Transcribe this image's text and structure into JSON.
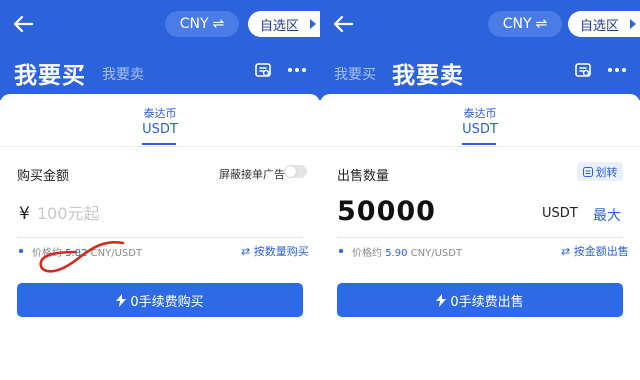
{
  "colors": {
    "brand": "#2c63dc",
    "button": "#2d6ae5",
    "scribble": "#d42a1d"
  },
  "buy": {
    "header": {
      "currency_label": "CNY",
      "currency_switch_icon": "swap-arrows-icon",
      "zone_label": "自选区",
      "tab_active": "我要买",
      "tab_inactive": "我要卖"
    },
    "coin": {
      "name": "泰达币",
      "symbol": "USDT"
    },
    "field_title": "购买金额",
    "hide_toggle_label": "屏蔽接单广告",
    "hide_toggle_on": false,
    "currency_symbol": "¥",
    "amount_placeholder": "100元起",
    "price_prefix": "价格约",
    "price_value": "5.82",
    "price_unit": "CNY/USDT",
    "switch_mode_label": "⇄ 按数量购买",
    "submit_label": "0手续费购买"
  },
  "sell": {
    "header": {
      "currency_label": "CNY",
      "zone_label": "自选区",
      "tab_inactive": "我要买",
      "tab_active": "我要卖"
    },
    "coin": {
      "name": "泰达币",
      "symbol": "USDT"
    },
    "field_title": "出售数量",
    "transfer_label": "划转",
    "quantity": "50000",
    "unit": "USDT",
    "max_label": "最大",
    "price_prefix": "价格约",
    "price_value": "5.90",
    "price_unit": "CNY/USDT",
    "switch_mode_label": "⇄ 按金额出售",
    "submit_label": "0手续费出售"
  }
}
